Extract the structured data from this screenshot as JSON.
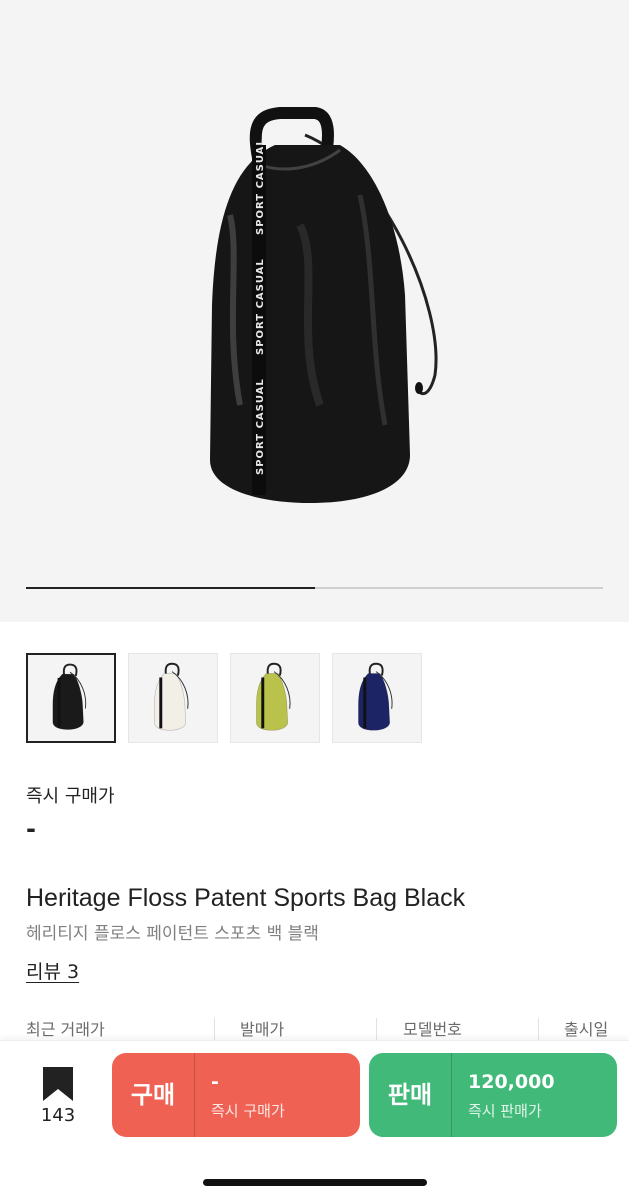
{
  "gallery": {
    "image_label": "SPORT CASUAL",
    "progress": 0.5,
    "thumbnails": [
      {
        "name": "black",
        "color": "#1a1a1a",
        "selected": true
      },
      {
        "name": "white",
        "color": "#f2efe6",
        "selected": false
      },
      {
        "name": "olive",
        "color": "#b9c24a",
        "selected": false
      },
      {
        "name": "navy",
        "color": "#1d2466",
        "selected": false
      }
    ]
  },
  "price": {
    "label": "즉시 구매가",
    "value": "-"
  },
  "product": {
    "title": "Heritage Floss Patent Sports Bag Black",
    "subtitle": "헤리티지 플로스 페이턴트 스포츠 백 블랙",
    "review_link": "리뷰 3"
  },
  "info_columns": [
    "최근 거래가",
    "발매가",
    "모델번호",
    "출시일"
  ],
  "bottom_bar": {
    "bookmark_icon": "bookmark-icon",
    "bookmark_count": "143",
    "buy": {
      "label": "구매",
      "price": "-",
      "caption": "즉시 구매가",
      "color": "#ef6253"
    },
    "sell": {
      "label": "판매",
      "price": "120,000",
      "caption": "즉시 판매가",
      "color": "#41b979"
    }
  }
}
